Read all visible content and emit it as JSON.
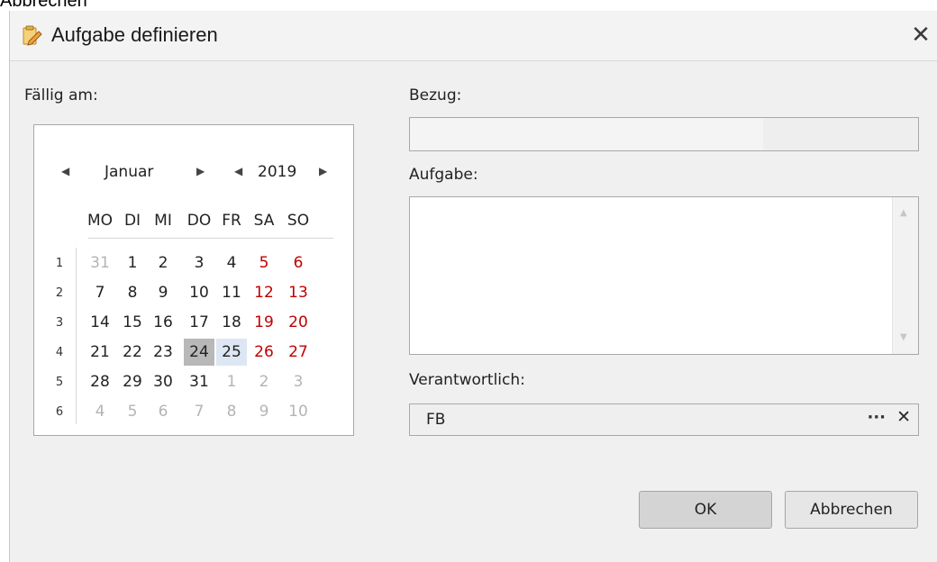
{
  "stray_label": "Abbrechen",
  "window": {
    "title": "Aufgabe definieren",
    "icon": "task-edit-icon",
    "close_icon": "close-icon",
    "close_glyph": "✕"
  },
  "labels": {
    "faellig": "Fällig am:",
    "bezug": "Bezug:",
    "aufgabe": "Aufgabe:",
    "verantwortlich": "Verantwortlich:"
  },
  "calendar": {
    "month": "Januar",
    "year": "2019",
    "weekdays": [
      "MO",
      "DI",
      "MI",
      "DO",
      "FR",
      "SA",
      "SO"
    ],
    "weeks": [
      {
        "num": "1",
        "days": [
          {
            "d": "31",
            "t": "other"
          },
          {
            "d": "1"
          },
          {
            "d": "2"
          },
          {
            "d": "3"
          },
          {
            "d": "4"
          },
          {
            "d": "5",
            "t": "weekend"
          },
          {
            "d": "6",
            "t": "weekend"
          }
        ]
      },
      {
        "num": "2",
        "days": [
          {
            "d": "7"
          },
          {
            "d": "8"
          },
          {
            "d": "9"
          },
          {
            "d": "10"
          },
          {
            "d": "11"
          },
          {
            "d": "12",
            "t": "weekend"
          },
          {
            "d": "13",
            "t": "weekend"
          }
        ]
      },
      {
        "num": "3",
        "days": [
          {
            "d": "14"
          },
          {
            "d": "15"
          },
          {
            "d": "16"
          },
          {
            "d": "17"
          },
          {
            "d": "18"
          },
          {
            "d": "19",
            "t": "weekend"
          },
          {
            "d": "20",
            "t": "weekend"
          }
        ]
      },
      {
        "num": "4",
        "days": [
          {
            "d": "21"
          },
          {
            "d": "22"
          },
          {
            "d": "23"
          },
          {
            "d": "24",
            "t": "selected"
          },
          {
            "d": "25",
            "t": "hover"
          },
          {
            "d": "26",
            "t": "weekend"
          },
          {
            "d": "27",
            "t": "weekend"
          }
        ]
      },
      {
        "num": "5",
        "days": [
          {
            "d": "28"
          },
          {
            "d": "29"
          },
          {
            "d": "30"
          },
          {
            "d": "31"
          },
          {
            "d": "1",
            "t": "other"
          },
          {
            "d": "2",
            "t": "other"
          },
          {
            "d": "3",
            "t": "other"
          }
        ]
      },
      {
        "num": "6",
        "days": [
          {
            "d": "4",
            "t": "other"
          },
          {
            "d": "5",
            "t": "other"
          },
          {
            "d": "6",
            "t": "other"
          },
          {
            "d": "7",
            "t": "other"
          },
          {
            "d": "8",
            "t": "other"
          },
          {
            "d": "9",
            "t": "other"
          },
          {
            "d": "10",
            "t": "other"
          }
        ]
      }
    ]
  },
  "fields": {
    "bezug": {
      "value": ""
    },
    "aufgabe": {
      "value": ""
    },
    "verantwortlich": {
      "value": "FB",
      "browse_glyph": "···",
      "clear_glyph": "✕"
    }
  },
  "buttons": {
    "ok": "OK",
    "cancel": "Abbrechen"
  },
  "colors": {
    "weekend": "#c00000",
    "selected": "#b8b8b8",
    "hover": "#dde6f3",
    "other": "#b4b4b4"
  }
}
